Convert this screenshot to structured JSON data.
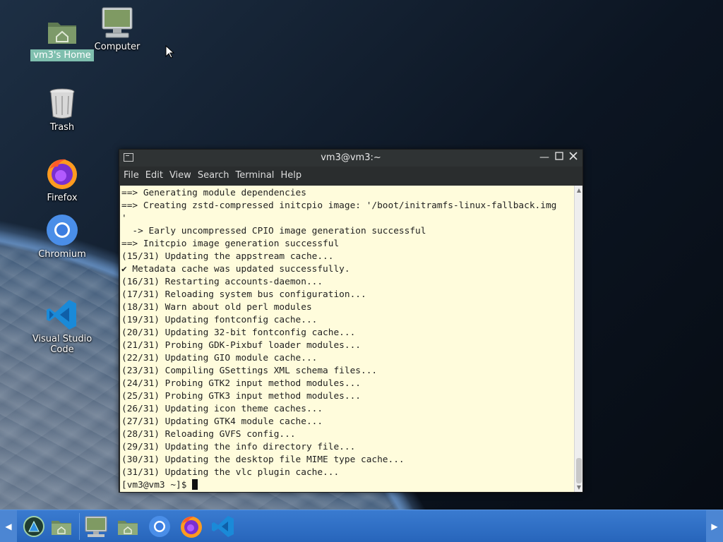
{
  "desktop": {
    "icons": [
      {
        "label": "vm3's Home",
        "icon": "home-folder-icon"
      },
      {
        "label": "Computer",
        "icon": "computer-icon"
      },
      {
        "label": "Trash",
        "icon": "trash-icon"
      },
      {
        "label": "Firefox",
        "icon": "firefox-icon"
      },
      {
        "label": "Chromium",
        "icon": "chromium-icon"
      },
      {
        "label": "Visual Studio Code",
        "icon": "vscode-icon"
      }
    ]
  },
  "terminal": {
    "title": "vm3@vm3:~",
    "menu": [
      "File",
      "Edit",
      "View",
      "Search",
      "Terminal",
      "Help"
    ],
    "lines": [
      "==> Generating module dependencies",
      "==> Creating zstd-compressed initcpio image: '/boot/initramfs-linux-fallback.img",
      "'",
      "  -> Early uncompressed CPIO image generation successful",
      "==> Initcpio image generation successful",
      "(15/31) Updating the appstream cache...",
      "✔ Metadata cache was updated successfully.",
      "(16/31) Restarting accounts-daemon...",
      "(17/31) Reloading system bus configuration...",
      "(18/31) Warn about old perl modules",
      "(19/31) Updating fontconfig cache...",
      "(20/31) Updating 32-bit fontconfig cache...",
      "(21/31) Probing GDK-Pixbuf loader modules...",
      "(22/31) Updating GIO module cache...",
      "(23/31) Compiling GSettings XML schema files...",
      "(24/31) Probing GTK2 input method modules...",
      "(25/31) Probing GTK3 input method modules...",
      "(26/31) Updating icon theme caches...",
      "(27/31) Updating GTK4 module cache...",
      "(28/31) Reloading GVFS config...",
      "(29/31) Updating the info directory file...",
      "(30/31) Updating the desktop file MIME type cache...",
      "(31/31) Updating the vlc plugin cache..."
    ],
    "prompt": "[vm3@vm3 ~]$ "
  },
  "taskbar": {
    "items": [
      "menu-icon",
      "file-manager-icon",
      "computer-icon",
      "home-folder-icon",
      "chromium-icon",
      "firefox-icon",
      "vscode-icon"
    ]
  },
  "colors": {
    "taskbar": "#2f6fc6",
    "terminal_bg": "#fffcdc",
    "selection": "#7fbfae"
  }
}
